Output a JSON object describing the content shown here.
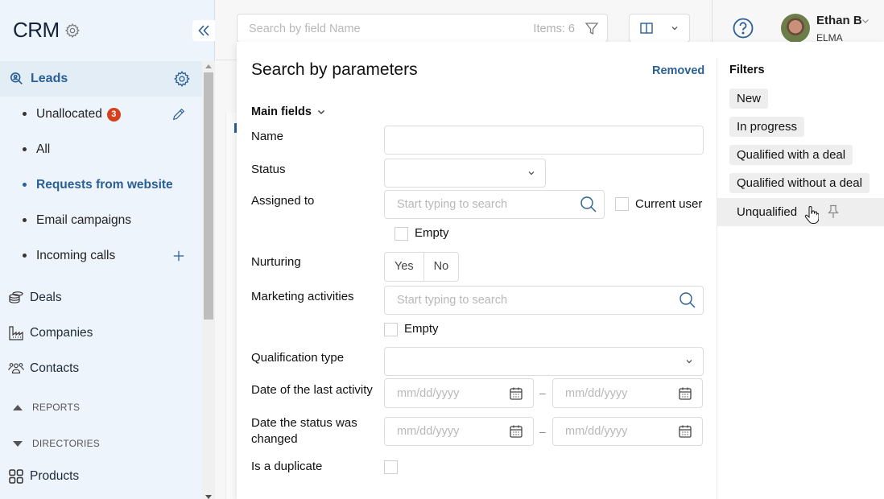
{
  "app": {
    "title": "CRM"
  },
  "sidebar": {
    "leads": {
      "label": "Leads"
    },
    "lead_items": [
      {
        "label": "Unallocated",
        "badge": "3",
        "action": "pencil-icon"
      },
      {
        "label": "All"
      },
      {
        "label": "Requests from website",
        "active": true
      },
      {
        "label": "Email campaigns"
      },
      {
        "label": "Incoming calls",
        "action": "plus-icon"
      }
    ],
    "main_items": [
      {
        "label": "Deals",
        "icon": "coins-stack-icon"
      },
      {
        "label": "Companies",
        "icon": "factory-icon"
      },
      {
        "label": "Contacts",
        "icon": "people-icon"
      }
    ],
    "sections": [
      {
        "label": "REPORTS",
        "state": "collapsed-up"
      },
      {
        "label": "DIRECTORIES",
        "state": "expanded"
      }
    ],
    "directory_items": [
      {
        "label": "Products",
        "icon": "grid-icon"
      }
    ]
  },
  "topbar": {
    "search_placeholder": "Search by field Name",
    "items_count": "Items: 6",
    "user_name": "Ethan B",
    "user_org": "ELMA"
  },
  "popup": {
    "title": "Search by parameters",
    "removed_label": "Removed",
    "main_fields_label": "Main fields",
    "fields": {
      "name": {
        "label": "Name",
        "value": ""
      },
      "status": {
        "label": "Status",
        "value": ""
      },
      "assigned_to": {
        "label": "Assigned to",
        "placeholder": "Start typing to search",
        "current_user_label": "Current user",
        "empty_label": "Empty"
      },
      "nurturing": {
        "label": "Nurturing",
        "yes": "Yes",
        "no": "No"
      },
      "marketing_activities": {
        "label": "Marketing activities",
        "placeholder": "Start typing to search",
        "empty_label": "Empty"
      },
      "qualification_type": {
        "label": "Qualification type",
        "value": ""
      },
      "last_activity": {
        "label": "Date of the last activity",
        "from_placeholder": "mm/dd/yyyy",
        "to_placeholder": "mm/dd/yyyy"
      },
      "status_changed": {
        "label": "Date the status was changed",
        "from_placeholder": "mm/dd/yyyy",
        "to_placeholder": "mm/dd/yyyy"
      },
      "is_duplicate": {
        "label": "Is a duplicate",
        "checked": false
      }
    },
    "range_separator": "–",
    "filters": {
      "title": "Filters",
      "items": [
        "New",
        "In progress",
        "Qualified with a deal",
        "Qualified without a deal",
        "Unqualified"
      ],
      "hovered": "Unqualified"
    }
  },
  "colors": {
    "accent": "#2a5f96",
    "badge": "#d5411c",
    "sidebar_bg": "#eef4fb"
  }
}
